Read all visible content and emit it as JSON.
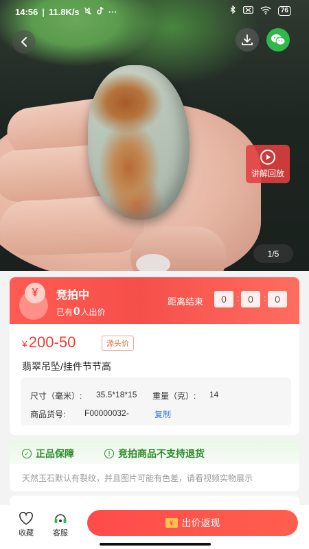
{
  "status_bar": {
    "time": "14:56",
    "network_speed": "11.8K/s",
    "more": "···",
    "battery": "76"
  },
  "gallery": {
    "page_indicator": "1/5",
    "replay_label": "讲解回放"
  },
  "auction": {
    "status": "竞拍中",
    "bids_prefix": "已有",
    "bid_count": "0",
    "bids_suffix": "人出价",
    "countdown_label": "距离结束",
    "countdown": [
      "0",
      "0",
      "0"
    ],
    "coin_symbol": "¥"
  },
  "product": {
    "price_symbol": "¥",
    "price_range": "200-50",
    "source_tag": "源头价",
    "title": "翡翠吊坠/挂件节节高",
    "spec": {
      "size_label": "尺寸（毫米）:",
      "size_value": "35.5*18*15",
      "weight_label": "重量（克）:",
      "weight_value": "14",
      "sku_label": "商品货号:",
      "sku_value": "F00000032-",
      "copy_label": "复制"
    }
  },
  "guarantee": {
    "authentic": "正品保障",
    "no_return": "竞拍商品不支持退货",
    "note": "天然玉石默认有裂纹，并且图片可能有色差，请看视频实物展示"
  },
  "bottom_bar": {
    "favorite_label": "收藏",
    "service_label": "客服",
    "bid_button_label": "出价返现",
    "bid_icon_text": "¥"
  },
  "colors": {
    "accent_red": "#f23c32",
    "guarantee_green": "#2a8a2a",
    "wechat_green": "#2fb94a"
  }
}
